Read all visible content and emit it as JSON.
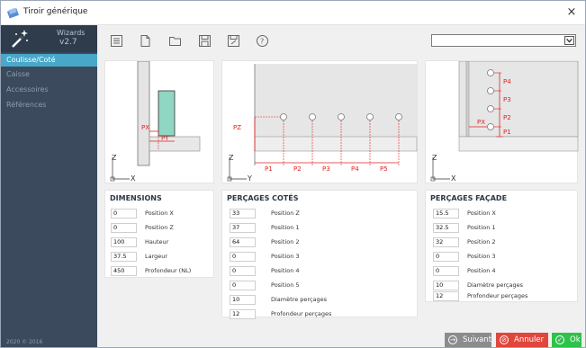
{
  "window": {
    "title": "Tiroir générique",
    "close_label": "×"
  },
  "sidebar": {
    "app_name": "Wizards",
    "version": "v2.7",
    "items": [
      {
        "label": "Coulisse/Coté",
        "active": true
      },
      {
        "label": "Caisse",
        "active": false
      },
      {
        "label": "Accessoires",
        "active": false
      },
      {
        "label": "Références",
        "active": false
      }
    ],
    "copyright": "2020 © 2016"
  },
  "toolbar": {
    "icons": [
      "settings-icon",
      "new-document-icon",
      "open-folder-icon",
      "save-icon",
      "save-as-icon",
      "help-icon"
    ],
    "dropdown_value": ""
  },
  "diagrams": {
    "left": {
      "labels": [
        "PX",
        "PY",
        "Z",
        "X"
      ]
    },
    "middle": {
      "labels": [
        "PZ",
        "Z",
        "Y",
        "P1",
        "P2",
        "P3",
        "P4",
        "P5"
      ]
    },
    "right": {
      "labels": [
        "P4",
        "P3",
        "P2",
        "PX",
        "P1",
        "Z",
        "X"
      ]
    }
  },
  "dimensions": {
    "title": "DIMENSIONS",
    "rows": [
      {
        "value": "0",
        "label": "Position X"
      },
      {
        "value": "0",
        "label": "Position Z"
      },
      {
        "value": "100",
        "label": "Hauteur"
      },
      {
        "value": "37.5",
        "label": "Largeur"
      },
      {
        "value": "450",
        "label": "Profondeur (NL)"
      }
    ]
  },
  "percages_cotes": {
    "title": "PERÇAGES COTÉS",
    "rows": [
      {
        "value": "33",
        "label": "Position Z"
      },
      {
        "value": "37",
        "label": "Position 1"
      },
      {
        "value": "64",
        "label": "Position 2"
      },
      {
        "value": "0",
        "label": "Position 3"
      },
      {
        "value": "0",
        "label": "Position 4"
      },
      {
        "value": "0",
        "label": "Position 5"
      },
      {
        "value": "10",
        "label": "Diamètre perçages"
      },
      {
        "value": "12",
        "label": "Profondeur perçages"
      }
    ]
  },
  "percages_facade": {
    "title": "PERÇAGES FAÇADE",
    "rows": [
      {
        "value": "15.5",
        "label": "Position X"
      },
      {
        "value": "32.5",
        "label": "Position 1"
      },
      {
        "value": "32",
        "label": "Position 2"
      },
      {
        "value": "0",
        "label": "Position 3"
      },
      {
        "value": "0",
        "label": "Position 4"
      },
      {
        "value": "10",
        "label": "Diamètre perçages"
      },
      {
        "value": "12",
        "label": "Profondeur perçages"
      }
    ]
  },
  "buttons": {
    "next": "Suivant",
    "cancel": "Annuler",
    "ok": "Ok"
  },
  "colors": {
    "sidebar": "#3b4a5c",
    "active": "#47a8c9",
    "next": "#8c8c8c",
    "cancel": "#e0463c",
    "ok": "#2ec24a",
    "dimension_red": "#e02020",
    "slide_green": "#8fd6c3"
  }
}
